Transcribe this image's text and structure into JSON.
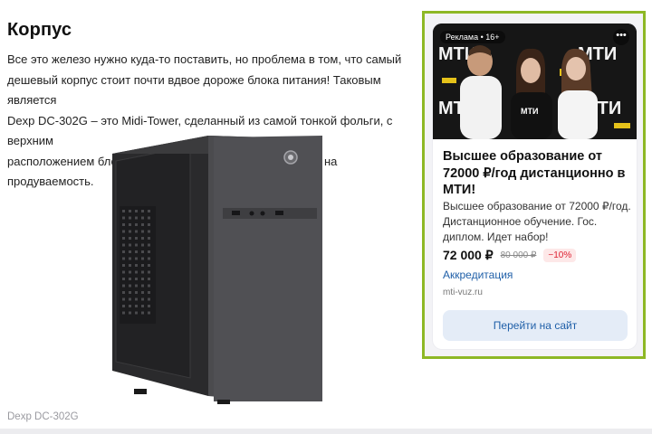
{
  "article": {
    "title": "Корпус",
    "paragraph_lines": [
      "Все это железо нужно куда-то поставить, но проблема в том, что самый",
      "дешевый корпус стоит почти вдвое дороже блока питания! Таковым является",
      "Dexp DC-302G – это Midi-Tower, сделанный из самой тонкой фольги, с верхним",
      "расположением блока питания и без каких-либо намеков на продуваемость."
    ],
    "image_caption": "Dexp DC-302G"
  },
  "ad": {
    "label": "Реклама • 16+",
    "photo_text": [
      "МТИ",
      "МТИ",
      "МТИ",
      "МТИ"
    ],
    "headline": "Высшее образование от 72000 ₽/год дистанционно в МТИ!",
    "description": "Высшее образование от 72000 ₽/год. Дистанционное обучение. Гос. диплом. Идет набор!",
    "price": "72 000 ₽",
    "old_price": "80 000 ₽",
    "discount": "−10%",
    "link": "Аккредитация",
    "domain": "mti-vuz.ru",
    "button": "Перейти на сайт",
    "menu_icon": "more-dots-icon"
  },
  "colors": {
    "ad_frame": "#8eb825",
    "link": "#1f5fa8",
    "discount": "#dd2233"
  }
}
